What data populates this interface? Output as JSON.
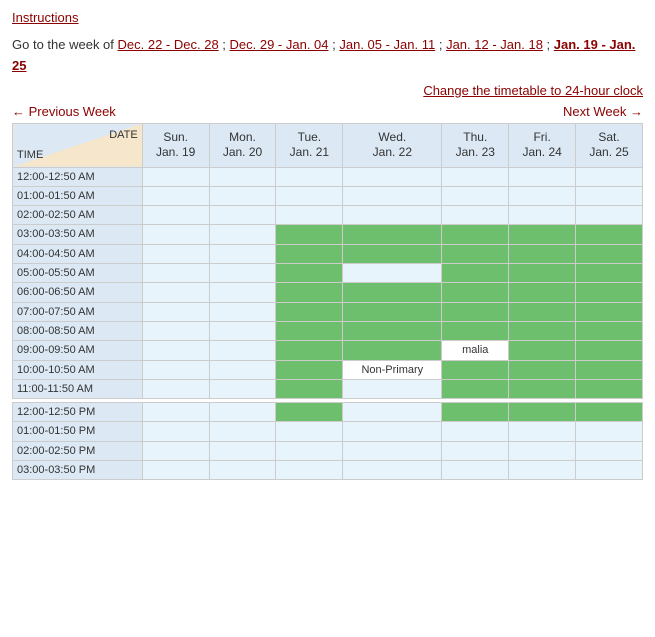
{
  "links": {
    "instructions": "Instructions",
    "clock": "Change the timetable to 24-hour clock",
    "prev_week": "← Previous Week",
    "next_week": "Next Week →"
  },
  "nav_text": {
    "prefix": "Go to the week of ",
    "weeks": [
      {
        "label": "Dec. 22 - Dec. 28",
        "bold": false
      },
      {
        "label": "Dec. 29 - Jan. 04",
        "bold": false
      },
      {
        "label": "Jan. 05 - Jan. 11",
        "bold": false
      },
      {
        "label": "Jan. 12 - Jan. 18",
        "bold": false
      },
      {
        "label": "Jan. 19 - Jan. 25",
        "bold": true
      }
    ]
  },
  "table": {
    "header": {
      "datetime_date": "DATE",
      "datetime_time": "TIME",
      "days": [
        {
          "label": "Sun.",
          "date": "Jan. 19"
        },
        {
          "label": "Mon.",
          "date": "Jan. 20"
        },
        {
          "label": "Tue.",
          "date": "Jan. 21"
        },
        {
          "label": "Wed.",
          "date": "Jan. 22"
        },
        {
          "label": "Thu.",
          "date": "Jan. 23"
        },
        {
          "label": "Fri.",
          "date": "Jan. 24"
        },
        {
          "label": "Sat.",
          "date": "Jan. 25"
        }
      ]
    },
    "rows": [
      {
        "time": "12:00-12:50 AM",
        "cells": [
          "empty",
          "empty",
          "empty",
          "empty",
          "empty",
          "empty",
          "empty"
        ]
      },
      {
        "time": "01:00-01:50 AM",
        "cells": [
          "empty",
          "empty",
          "empty",
          "empty",
          "empty",
          "empty",
          "empty"
        ]
      },
      {
        "time": "02:00-02:50 AM",
        "cells": [
          "empty",
          "empty",
          "empty",
          "empty",
          "empty",
          "empty",
          "empty"
        ]
      },
      {
        "time": "03:00-03:50 AM",
        "cells": [
          "empty",
          "empty",
          "green",
          "green",
          "green",
          "green",
          "green"
        ]
      },
      {
        "time": "04:00-04:50 AM",
        "cells": [
          "empty",
          "empty",
          "green",
          "green",
          "green",
          "green",
          "green"
        ]
      },
      {
        "time": "05:00-05:50 AM",
        "cells": [
          "empty",
          "empty",
          "green",
          "empty",
          "green",
          "green",
          "green"
        ]
      },
      {
        "time": "06:00-06:50 AM",
        "cells": [
          "empty",
          "empty",
          "green",
          "green",
          "green",
          "green",
          "green"
        ]
      },
      {
        "time": "07:00-07:50 AM",
        "cells": [
          "empty",
          "empty",
          "green",
          "green",
          "green",
          "green",
          "green"
        ]
      },
      {
        "time": "08:00-08:50 AM",
        "cells": [
          "empty",
          "empty",
          "green",
          "green",
          "green",
          "green",
          "green"
        ]
      },
      {
        "time": "09:00-09:50 AM",
        "cells": [
          "empty",
          "empty",
          "green",
          "green",
          "label_malia",
          "green",
          "green"
        ]
      },
      {
        "time": "10:00-10:50 AM",
        "cells": [
          "empty",
          "empty",
          "green",
          "label_nonprimary",
          "green",
          "green",
          "green"
        ]
      },
      {
        "time": "11:00-11:50 AM",
        "cells": [
          "empty",
          "empty",
          "green",
          "empty",
          "green",
          "green",
          "green"
        ]
      },
      {
        "separator": true
      },
      {
        "time": "12:00-12:50 PM",
        "cells": [
          "empty",
          "empty",
          "green",
          "empty",
          "green",
          "green",
          "green"
        ]
      },
      {
        "time": "01:00-01:50 PM",
        "cells": [
          "empty",
          "empty",
          "empty",
          "empty",
          "empty",
          "empty",
          "empty"
        ]
      },
      {
        "time": "02:00-02:50 PM",
        "cells": [
          "empty",
          "empty",
          "empty",
          "empty",
          "empty",
          "empty",
          "empty"
        ]
      },
      {
        "time": "03:00-03:50 PM",
        "cells": [
          "empty",
          "empty",
          "empty",
          "empty",
          "empty",
          "empty",
          "empty"
        ]
      }
    ],
    "labels": {
      "malia": "malia",
      "non_primary": "Non-Primary"
    }
  }
}
